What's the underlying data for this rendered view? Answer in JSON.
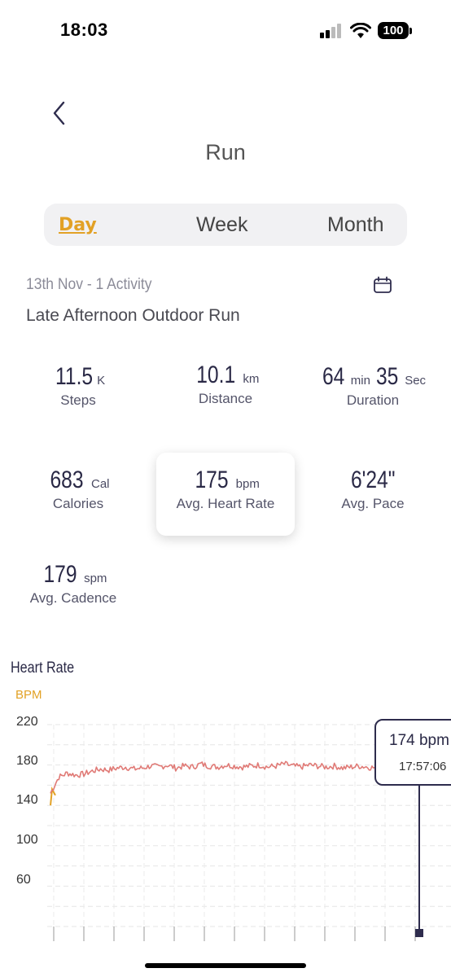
{
  "status_bar": {
    "time": "18:03",
    "battery": "100"
  },
  "header": {
    "title": "Run"
  },
  "tabs": [
    {
      "label": "Day",
      "active": true
    },
    {
      "label": "Week",
      "active": false
    },
    {
      "label": "Month",
      "active": false
    }
  ],
  "activity": {
    "date_line": "13th Nov - 1 Activity",
    "name": "Late Afternoon Outdoor Run"
  },
  "stats": {
    "steps": {
      "value": "11.5",
      "unit": "K",
      "label": "Steps"
    },
    "distance": {
      "value": "10.1",
      "unit": "km",
      "label": "Distance"
    },
    "duration": {
      "min_value": "64",
      "min_unit": "min",
      "sec_value": "35",
      "sec_unit": "Sec",
      "label": "Duration"
    },
    "calories": {
      "value": "683",
      "unit": "Cal",
      "label": "Calories"
    },
    "heart_rate": {
      "value": "175",
      "unit": "bpm",
      "label": "Avg. Heart Rate"
    },
    "pace": {
      "value": "6'24\"",
      "label": "Avg. Pace"
    },
    "cadence": {
      "value": "179",
      "unit": "spm",
      "label": "Avg. Cadence"
    }
  },
  "chart": {
    "title": "Heart Rate",
    "unit_label": "BPM",
    "tooltip": {
      "value": "174 bpm",
      "time": "17:57:06"
    }
  },
  "colors": {
    "accent": "#e2a125",
    "line": "#e07a76",
    "dark": "#2e2c4d"
  },
  "chart_data": {
    "type": "line",
    "title": "Heart Rate",
    "ylabel": "BPM",
    "y_ticks": [
      "220",
      "180",
      "140",
      "100",
      "60"
    ],
    "ylim": [
      20,
      220
    ],
    "series": [
      {
        "values": [
          152,
          168,
          172,
          170,
          171,
          174,
          176,
          175,
          177,
          178,
          176,
          177,
          179,
          178,
          180,
          177,
          179,
          178,
          181,
          179,
          178,
          180,
          179,
          178,
          179,
          180,
          178,
          179,
          181,
          179,
          178,
          180,
          179,
          178,
          179,
          177,
          178,
          179,
          178,
          177
        ]
      }
    ],
    "highlight": {
      "value": 174,
      "time": "17:57:06"
    }
  }
}
